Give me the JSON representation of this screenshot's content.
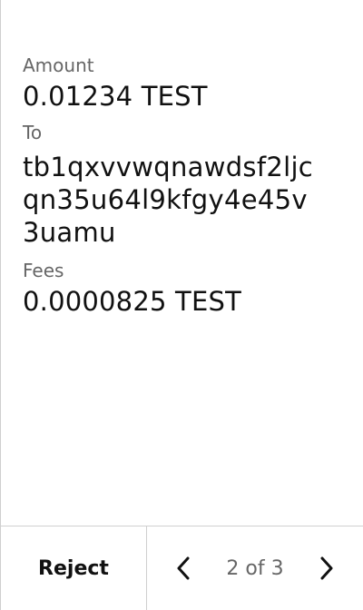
{
  "details": {
    "amount_label": "Amount",
    "amount_value": "0.01234 TEST",
    "to_label": "To",
    "to_address_lines": [
      "tb1qxvvwqnawdsf2ljc",
      "qn35u64l9kfgy4e45v",
      "3uamu"
    ],
    "fees_label": "Fees",
    "fees_value": "0.0000825 TEST"
  },
  "footer": {
    "reject_label": "Reject",
    "page_indicator": "2 of 3"
  },
  "icons": {
    "prev": "chevron-left-icon",
    "next": "chevron-right-icon"
  }
}
